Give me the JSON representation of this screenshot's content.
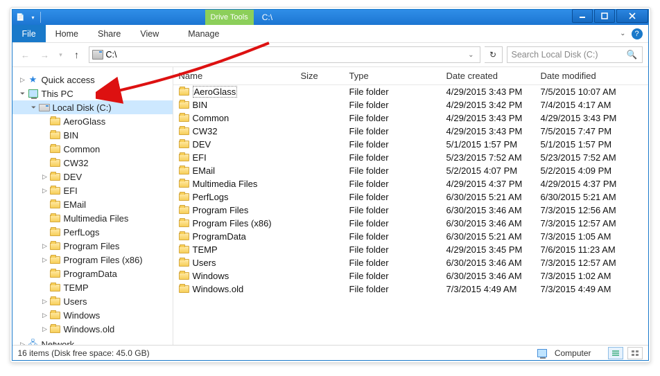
{
  "titlebar": {
    "drive_tools": "Drive Tools",
    "title": "C:\\"
  },
  "ribbon": {
    "file": "File",
    "home": "Home",
    "share": "Share",
    "view": "View",
    "manage": "Manage"
  },
  "addressbar": {
    "path": "C:\\"
  },
  "search": {
    "placeholder": "Search Local Disk (C:)"
  },
  "columns": {
    "name": "Name",
    "size": "Size",
    "type": "Type",
    "created": "Date created",
    "modified": "Date modified"
  },
  "tree": {
    "quick_access": "Quick access",
    "this_pc": "This PC",
    "local_disk": "Local Disk (C:)",
    "network": "Network",
    "folders": [
      "AeroGlass",
      "BIN",
      "Common",
      "CW32",
      "DEV",
      "EFI",
      "EMail",
      "Multimedia Files",
      "PerfLogs",
      "Program Files",
      "Program Files (x86)",
      "ProgramData",
      "TEMP",
      "Users",
      "Windows",
      "Windows.old"
    ]
  },
  "files": [
    {
      "name": "AeroGlass",
      "type": "File folder",
      "created": "4/29/2015 3:43 PM",
      "modified": "7/5/2015 10:07 AM"
    },
    {
      "name": "BIN",
      "type": "File folder",
      "created": "4/29/2015 3:42 PM",
      "modified": "7/4/2015 4:17 AM"
    },
    {
      "name": "Common",
      "type": "File folder",
      "created": "4/29/2015 3:43 PM",
      "modified": "4/29/2015 3:43 PM"
    },
    {
      "name": "CW32",
      "type": "File folder",
      "created": "4/29/2015 3:43 PM",
      "modified": "7/5/2015 7:47 PM"
    },
    {
      "name": "DEV",
      "type": "File folder",
      "created": "5/1/2015 1:57 PM",
      "modified": "5/1/2015 1:57 PM"
    },
    {
      "name": "EFI",
      "type": "File folder",
      "created": "5/23/2015 7:52 AM",
      "modified": "5/23/2015 7:52 AM"
    },
    {
      "name": "EMail",
      "type": "File folder",
      "created": "5/2/2015 4:07 PM",
      "modified": "5/2/2015 4:09 PM"
    },
    {
      "name": "Multimedia Files",
      "type": "File folder",
      "created": "4/29/2015 4:37 PM",
      "modified": "4/29/2015 4:37 PM"
    },
    {
      "name": "PerfLogs",
      "type": "File folder",
      "created": "6/30/2015 5:21 AM",
      "modified": "6/30/2015 5:21 AM"
    },
    {
      "name": "Program Files",
      "type": "File folder",
      "created": "6/30/2015 3:46 AM",
      "modified": "7/3/2015 12:56 AM"
    },
    {
      "name": "Program Files (x86)",
      "type": "File folder",
      "created": "6/30/2015 3:46 AM",
      "modified": "7/3/2015 12:57 AM"
    },
    {
      "name": "ProgramData",
      "type": "File folder",
      "created": "6/30/2015 5:21 AM",
      "modified": "7/3/2015 1:05 AM"
    },
    {
      "name": "TEMP",
      "type": "File folder",
      "created": "4/29/2015 3:45 PM",
      "modified": "7/6/2015 11:23 AM"
    },
    {
      "name": "Users",
      "type": "File folder",
      "created": "6/30/2015 3:46 AM",
      "modified": "7/3/2015 12:57 AM"
    },
    {
      "name": "Windows",
      "type": "File folder",
      "created": "6/30/2015 3:46 AM",
      "modified": "7/3/2015 1:02 AM"
    },
    {
      "name": "Windows.old",
      "type": "File folder",
      "created": "7/3/2015 4:49 AM",
      "modified": "7/3/2015 4:49 AM"
    }
  ],
  "status": {
    "text": "16 items (Disk free space: 45.0 GB)",
    "computer": "Computer"
  }
}
